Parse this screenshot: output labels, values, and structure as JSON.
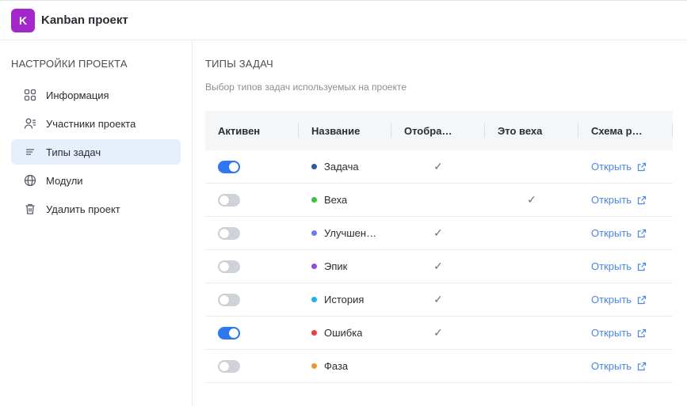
{
  "header": {
    "logo_letter": "K",
    "project_name": "Kanban проект",
    "logo_color": "#a428c9"
  },
  "sidebar": {
    "title": "НАСТРОЙКИ ПРОЕКТА",
    "items": [
      {
        "label": "Информация",
        "icon": "grid-icon",
        "active": false
      },
      {
        "label": "Участники проекта",
        "icon": "users-icon",
        "active": false
      },
      {
        "label": "Типы задач",
        "icon": "list-icon",
        "active": true
      },
      {
        "label": "Модули",
        "icon": "globe-icon",
        "active": false
      },
      {
        "label": "Удалить проект",
        "icon": "trash-icon",
        "active": false
      }
    ]
  },
  "main": {
    "title": "ТИПЫ ЗАДАЧ",
    "subtitle": "Выбор типов задач используемых на проекте",
    "columns": [
      "Активен",
      "Название",
      "Отобра…",
      "Это веха",
      "Схема р…"
    ],
    "open_label": "Открыть",
    "check_glyph": "✓",
    "rows": [
      {
        "active": true,
        "name": "Задача",
        "color": "#2c5aa0",
        "shown": true,
        "milestone": false
      },
      {
        "active": false,
        "name": "Веха",
        "color": "#3cc23c",
        "shown": false,
        "milestone": true
      },
      {
        "active": false,
        "name": "Улучшен…",
        "color": "#6b7cf0",
        "shown": true,
        "milestone": false
      },
      {
        "active": false,
        "name": "Эпик",
        "color": "#8a4fe0",
        "shown": true,
        "milestone": false
      },
      {
        "active": false,
        "name": "История",
        "color": "#1fb2e8",
        "shown": true,
        "milestone": false
      },
      {
        "active": true,
        "name": "Ошибка",
        "color": "#e84040",
        "shown": true,
        "milestone": false
      },
      {
        "active": false,
        "name": "Фаза",
        "color": "#f0962e",
        "shown": false,
        "milestone": false
      }
    ]
  }
}
